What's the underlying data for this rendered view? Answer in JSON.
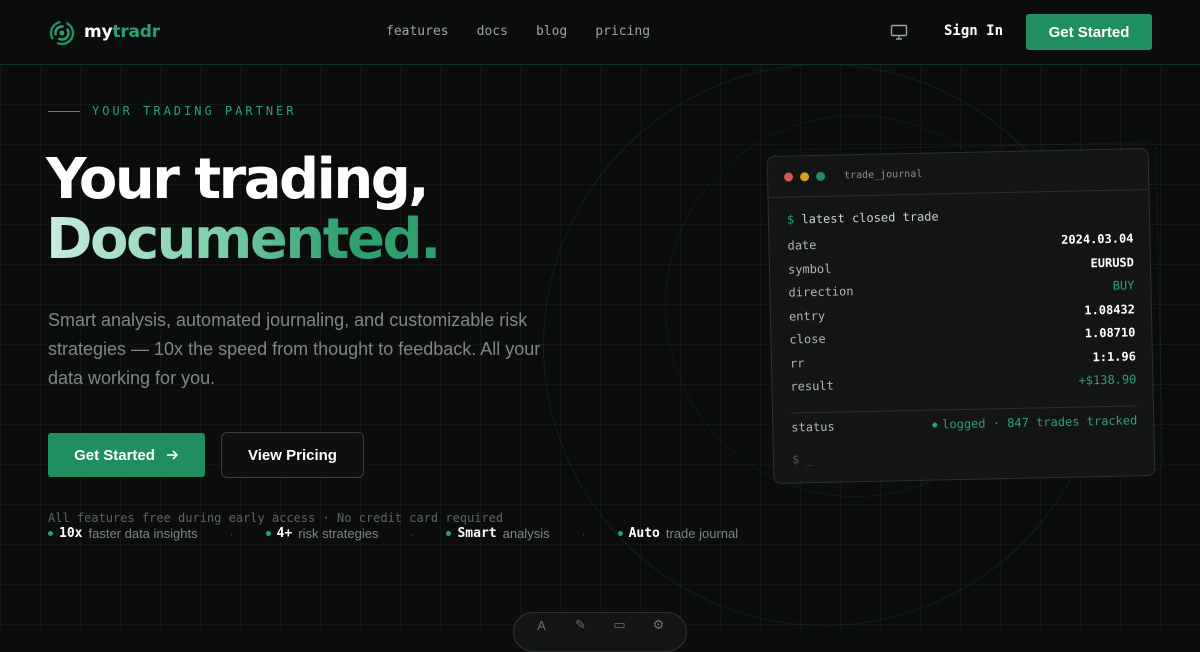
{
  "nav": {
    "brand_prefix": "my",
    "brand_accent": "tradr",
    "links": [
      "features",
      "docs",
      "blog",
      "pricing"
    ],
    "sign_in": "Sign In",
    "get_started": "Get Started"
  },
  "hero": {
    "eyebrow": "YOUR TRADING PARTNER",
    "title_line1": "Your trading,",
    "title_line2": "Documented",
    "title_dot": ".",
    "subtitle": "Smart analysis, automated journaling, and customizable risk strategies — 10x the speed from thought to feedback. All your data working for you.",
    "cta_primary": "Get Started",
    "cta_secondary": "View Pricing",
    "note": "All features free during early access · No credit card required",
    "stats": [
      {
        "value": "10x",
        "label": "faster data insights"
      },
      {
        "value": "4+",
        "label": "risk strategies"
      },
      {
        "value": "Smart",
        "label": "analysis"
      },
      {
        "value": "Auto",
        "label": "trade journal"
      }
    ],
    "stat_separator": "·"
  },
  "terminal": {
    "title": "trade_journal",
    "prompt_symbol": "$",
    "prompt_text": "latest closed trade",
    "rows": [
      {
        "key": "date",
        "value": "2024.03.04"
      },
      {
        "key": "symbol",
        "value": "EURUSD"
      },
      {
        "key": "direction",
        "value": "BUY"
      },
      {
        "key": "entry",
        "value": "1.08432"
      },
      {
        "key": "close",
        "value": "1.08710"
      },
      {
        "key": "rr",
        "value": "1:1.96"
      },
      {
        "key": "result",
        "value": "+$138.90"
      }
    ],
    "status_key": "status",
    "status_value": "logged · 847 trades tracked",
    "cursor": "$ _"
  },
  "colors": {
    "accent": "#2ea06e",
    "button": "#1f8f60",
    "background": "#0b0d0c"
  },
  "icons": [
    "logo-icon",
    "monitor-icon",
    "arrow-right-icon"
  ]
}
